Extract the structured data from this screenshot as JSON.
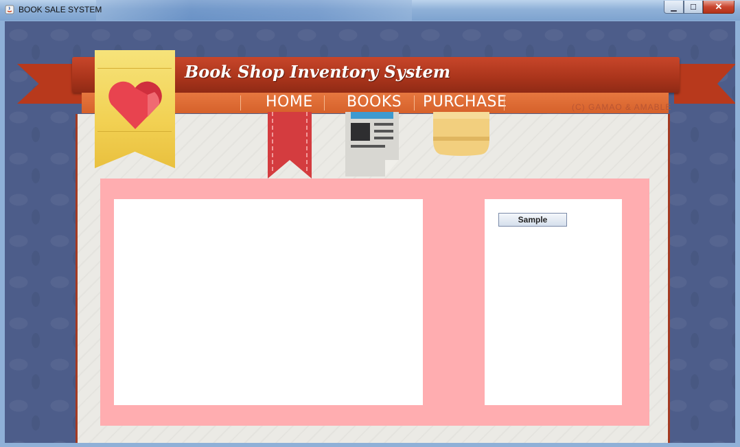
{
  "window": {
    "title": "BOOK SALE SYSTEM",
    "minimize_symbol": "▁",
    "maximize_symbol": "☐",
    "close_symbol": "✕"
  },
  "header": {
    "title": "Book Shop Inventory System",
    "credit": "(C) GAMAO & AMABLE"
  },
  "nav": {
    "items": [
      {
        "label": "HOME",
        "icon": "bookmark-icon"
      },
      {
        "label": "BOOKS",
        "icon": "newspaper-icon"
      },
      {
        "label": "PURCHASE",
        "icon": "box-icon"
      }
    ]
  },
  "sidebar": {
    "button_label": "Sample"
  },
  "colors": {
    "ribbon": "#b8391c",
    "nav_bar": "#e06b34",
    "badge": "#f2d153",
    "heart": "#e8434f",
    "pink_panel": "#ffadb0",
    "background": "#4d5d8a"
  }
}
